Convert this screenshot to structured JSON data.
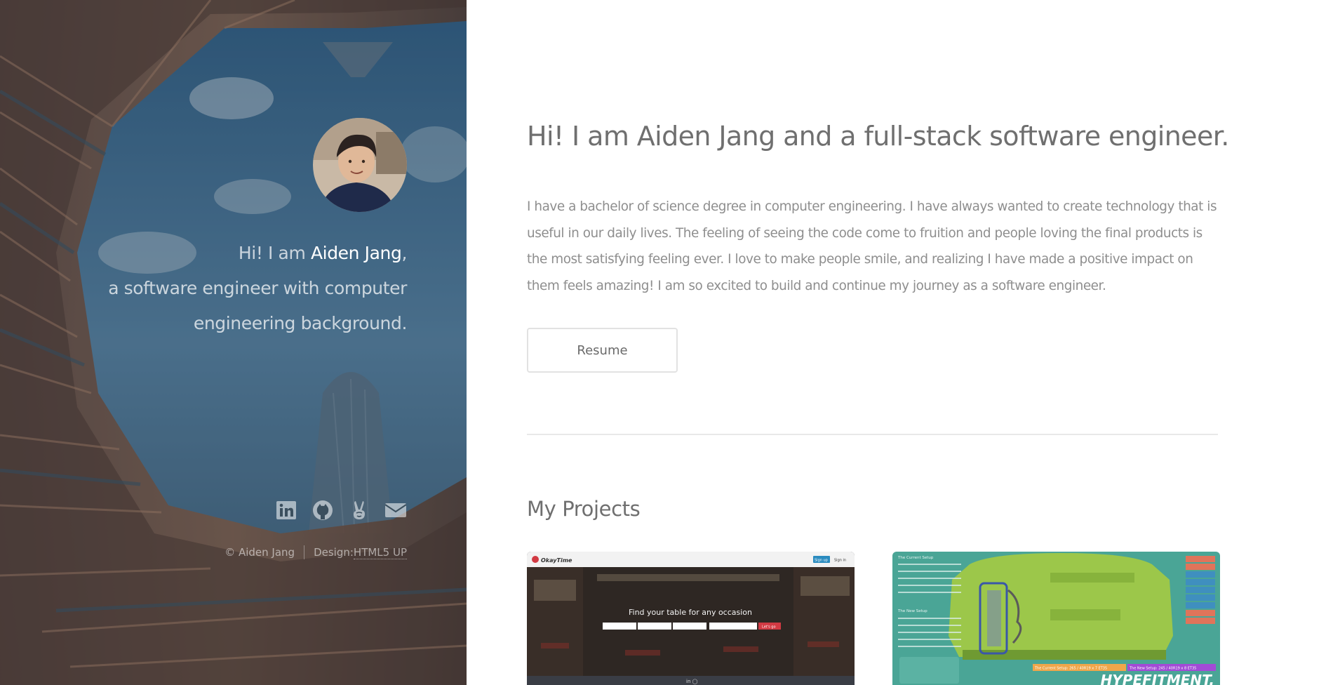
{
  "sidebar": {
    "intro_prefix": "Hi! I am ",
    "intro_name": "Aiden Jang",
    "intro_comma": ",",
    "intro_line2": "a software engineer with computer",
    "intro_line3": "engineering background.",
    "social": [
      {
        "icon": "linkedin-icon"
      },
      {
        "icon": "github-icon"
      },
      {
        "icon": "angellist-icon"
      },
      {
        "icon": "email-icon"
      }
    ],
    "copyright": "© Aiden Jang",
    "design_label": "Design: ",
    "design_link": "HTML5 UP"
  },
  "main": {
    "headline": "Hi! I am Aiden Jang and a full-stack software engineer.",
    "bio": "I have a bachelor of science degree in computer engineering. I have always wanted to create technology that is useful in our daily lives. The feeling of seeing the code come to fruition and people loving the final products is the most satisfying feeling ever. I love to make people smile, and realizing I have made a positive impact on them feels amazing! I am so excited to build and continue my journey as a software engineer.",
    "resume_label": "Resume",
    "projects_heading": "My Projects",
    "projects": [
      {
        "logo": "OkayTime",
        "signup": "Sign up",
        "signin": "Sign in",
        "tagline": "Find your table for any occasion",
        "cta": "Let's go"
      },
      {
        "brand": "HYPEFITMENT.",
        "current_setup": "The Current Setup",
        "new_setup": "The New Setup",
        "menu": [
          "Ride Comfort",
          "Ride Noise",
          "Wet Traction",
          "Dry Traction",
          "Looks",
          "Handling",
          "Stability",
          "Fuel Efficiency",
          "Cost"
        ],
        "current_bar": "The Current Setup: 265 / 40R19 x 7 ET35",
        "new_bar": "The New Setup: 245 / 40R19 x 8 ET35"
      }
    ]
  },
  "colors": {
    "sidebar_overlay": "#2f4a5c",
    "heading": "#6f6f6f",
    "body_text": "#8e8e8e",
    "card2_bg": "#4aa596",
    "card2_car": "#9cc74a",
    "okaytime_cta": "#d23a43"
  }
}
